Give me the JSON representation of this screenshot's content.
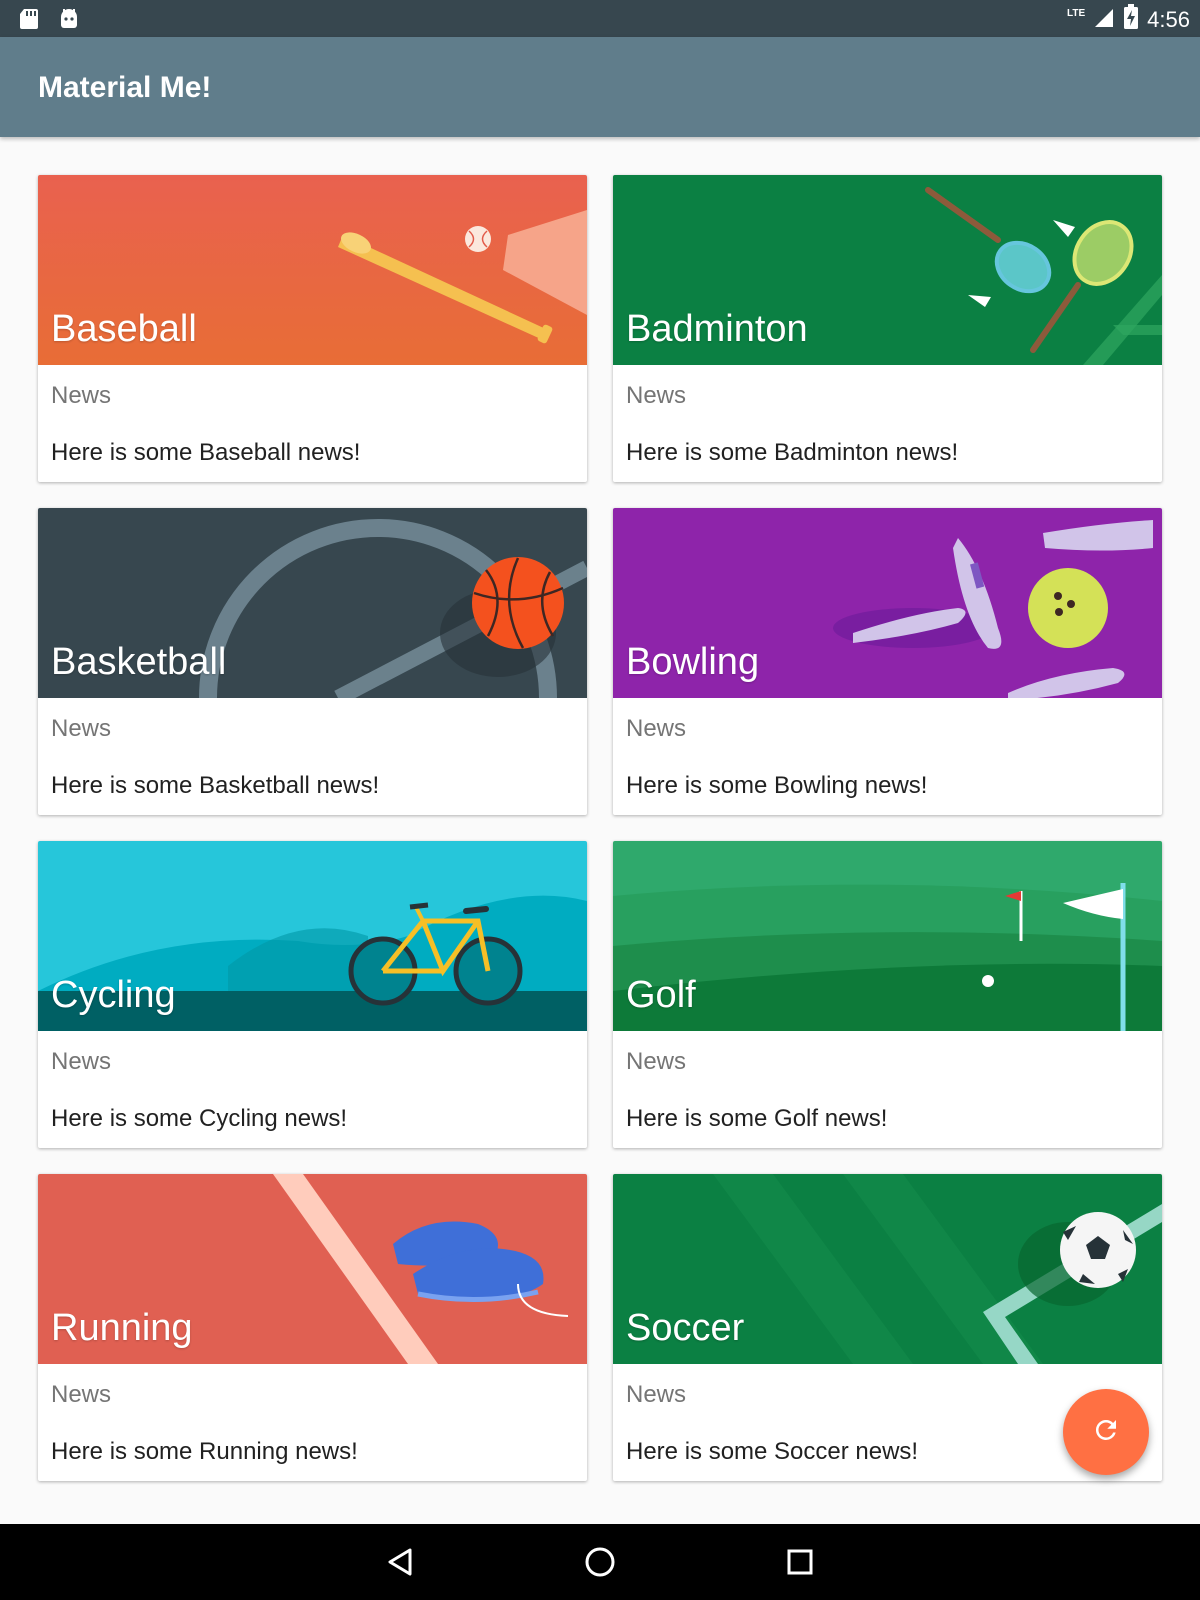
{
  "status_bar": {
    "time": "4:56",
    "network": "LTE"
  },
  "app_bar": {
    "title": "Material Me!"
  },
  "cards": [
    {
      "title": "Baseball",
      "subtitle": "News",
      "text": "Here is some Baseball news!"
    },
    {
      "title": "Badminton",
      "subtitle": "News",
      "text": "Here is some Badminton news!"
    },
    {
      "title": "Basketball",
      "subtitle": "News",
      "text": "Here is some Basketball news!"
    },
    {
      "title": "Bowling",
      "subtitle": "News",
      "text": "Here is some Bowling news!"
    },
    {
      "title": "Cycling",
      "subtitle": "News",
      "text": "Here is some Cycling news!"
    },
    {
      "title": "Golf",
      "subtitle": "News",
      "text": "Here is some Golf news!"
    },
    {
      "title": "Running",
      "subtitle": "News",
      "text": "Here is some Running news!"
    },
    {
      "title": "Soccer",
      "subtitle": "News",
      "text": "Here is some Soccer news!"
    }
  ],
  "fab": {
    "icon": "refresh-icon",
    "color": "#ff7043"
  },
  "colors": {
    "app_bar": "#607d8b",
    "status_bar": "#37474f"
  }
}
